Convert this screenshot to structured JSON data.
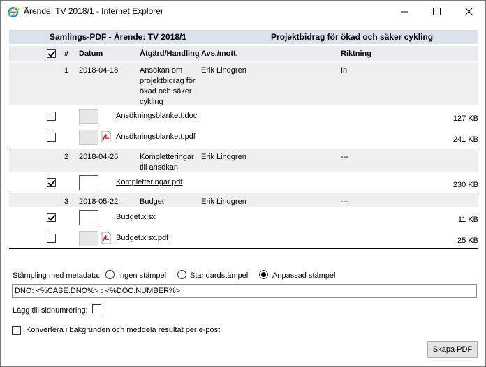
{
  "window": {
    "title": "Ärende: TV 2018/1 - Internet Explorer"
  },
  "header": {
    "left": "Samlings-PDF - Ärende: TV 2018/1",
    "right": "Projektbidrag för ökad och säker cykling"
  },
  "columns": {
    "num": "#",
    "date": "Datum",
    "action": "Åtgärd/Handling",
    "from_to": "Avs./mott.",
    "direction": "Riktning"
  },
  "groups": [
    {
      "num": "1",
      "date": "2018-04-18",
      "action_lines": [
        "Ansökan om",
        "projektbidrag för",
        "ökad och säker",
        "cykling"
      ],
      "from_to": "Erik Lindgren",
      "direction": "In",
      "files": [
        {
          "name": "Ansökningsblankett.doc",
          "size": "127 KB",
          "checked": false,
          "pdf": false
        },
        {
          "name": "Ansökningsblankett.pdf",
          "size": "241 KB",
          "checked": false,
          "pdf": true
        }
      ]
    },
    {
      "num": "2",
      "date": "2018-04-26",
      "action_lines": [
        "Kompletteringar",
        "till ansökan"
      ],
      "from_to": "Erik Lindgren",
      "direction": "---",
      "files": [
        {
          "name": "Kompletteringar.pdf",
          "size": "230 KB",
          "checked": true,
          "pdf": false
        }
      ]
    },
    {
      "num": "3",
      "date": "2018-05-22",
      "action_lines": [
        "Budget"
      ],
      "from_to": "Erik Lindgren",
      "direction": "---",
      "files": [
        {
          "name": "Budget.xlsx",
          "size": "11 KB",
          "checked": true,
          "pdf": false
        },
        {
          "name": "Budget.xlsx.pdf",
          "size": "25 KB",
          "checked": false,
          "pdf": true
        }
      ]
    }
  ],
  "stamping": {
    "label": "Stämpling med metadata:",
    "options": [
      "Ingen stämpel",
      "Standardstämpel",
      "Anpassad stämpel"
    ],
    "selected": "Anpassad stämpel",
    "value": "DNO: <%CASE.DNO%> : <%DOC.NUMBER%>"
  },
  "page_numbering_label": "Lägg till sidnumrering:",
  "background_label": "Konvertera i bakgrunden och meddela resultat per e-post",
  "create_button": "Skapa PDF"
}
